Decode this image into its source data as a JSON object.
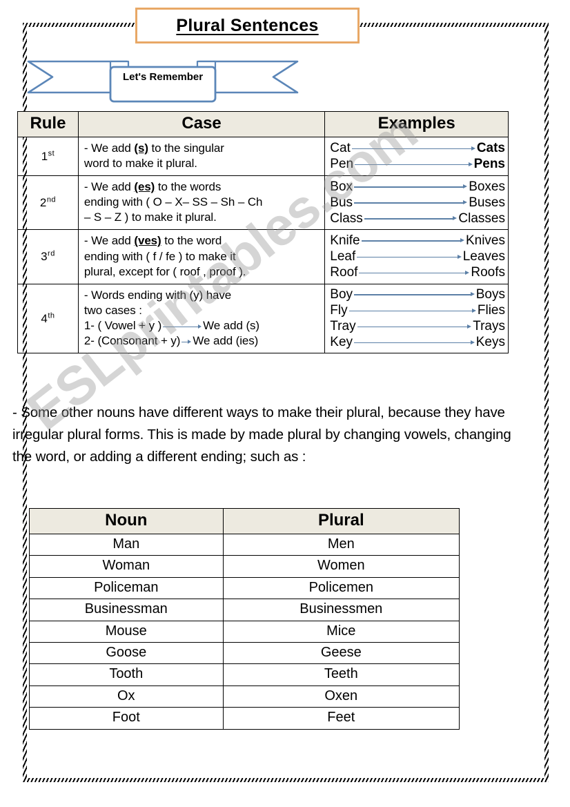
{
  "title": "Plural Sentences",
  "banner": {
    "label": "Let's Remember"
  },
  "watermark": "ESLprintables.com",
  "colors": {
    "title_border": "#E8A866",
    "banner_outline": "#5B86B8",
    "table_header_bg": "#EDEAE0",
    "arrow": "#5B7FA6"
  },
  "rules_table": {
    "headers": {
      "rule": "Rule",
      "case": "Case",
      "examples": "Examples"
    },
    "rows": [
      {
        "ordinal_num": "1",
        "ordinal_suffix": "st",
        "case_lines": [
          "- We add (s) to the singular",
          "word to make it plural."
        ],
        "emphasis": "(s)",
        "examples": [
          {
            "from": "Cat",
            "to": "Cats",
            "bold": true
          },
          {
            "from": "Pen",
            "to": "Pens",
            "bold": true
          }
        ]
      },
      {
        "ordinal_num": "2",
        "ordinal_suffix": "nd",
        "case_lines": [
          "- We add (es) to the words",
          "ending with ( O – X– SS – Sh – Ch",
          "– S – Z ) to make it plural."
        ],
        "emphasis": "(es)",
        "examples": [
          {
            "from": "Box",
            "to": "Boxes",
            "bold": false
          },
          {
            "from": "Bus",
            "to": "Buses",
            "bold": false
          },
          {
            "from": "Class",
            "to": "Classes",
            "bold": false
          }
        ]
      },
      {
        "ordinal_num": "3",
        "ordinal_suffix": "rd",
        "case_lines": [
          "- We add (ves) to the word",
          "ending with ( f / fe ) to make it",
          "plural, except for ( roof , proof )."
        ],
        "emphasis": "(ves)",
        "examples": [
          {
            "from": "Knife",
            "to": "Knives",
            "bold": false
          },
          {
            "from": "Leaf",
            "to": "Leaves",
            "bold": false
          },
          {
            "from": "Roof",
            "to": "Roofs",
            "bold": false
          }
        ]
      },
      {
        "ordinal_num": "4",
        "ordinal_suffix": "th",
        "case_lines": [
          "- Words ending with (y) have",
          "two cases :"
        ],
        "sub_cases": [
          {
            "label": "1- ( Vowel + y )",
            "result": "We add (s)"
          },
          {
            "label": "2- (Consonant + y)",
            "result": "We add (ies)"
          }
        ],
        "examples": [
          {
            "from": "Boy",
            "to": "Boys",
            "bold": false
          },
          {
            "from": "Fly",
            "to": "Flies",
            "bold": false
          },
          {
            "from": "Tray",
            "to": "Trays",
            "bold": false
          },
          {
            "from": "Key",
            "to": "Keys",
            "bold": false
          }
        ]
      }
    ]
  },
  "paragraph": "- Some other nouns have different ways to make their plural, because they have irregular plural forms. This is made by made plural by changing vowels, changing the word, or adding a different ending; such as :",
  "irregular_table": {
    "headers": {
      "noun": "Noun",
      "plural": "Plural"
    },
    "rows": [
      {
        "noun": "Man",
        "plural": "Men"
      },
      {
        "noun": "Woman",
        "plural": "Women"
      },
      {
        "noun": "Policeman",
        "plural": "Policemen"
      },
      {
        "noun": "Businessman",
        "plural": "Businessmen"
      },
      {
        "noun": "Mouse",
        "plural": "Mice"
      },
      {
        "noun": "Goose",
        "plural": "Geese"
      },
      {
        "noun": "Tooth",
        "plural": "Teeth"
      },
      {
        "noun": "Ox",
        "plural": "Oxen"
      },
      {
        "noun": "Foot",
        "plural": "Feet"
      }
    ]
  }
}
